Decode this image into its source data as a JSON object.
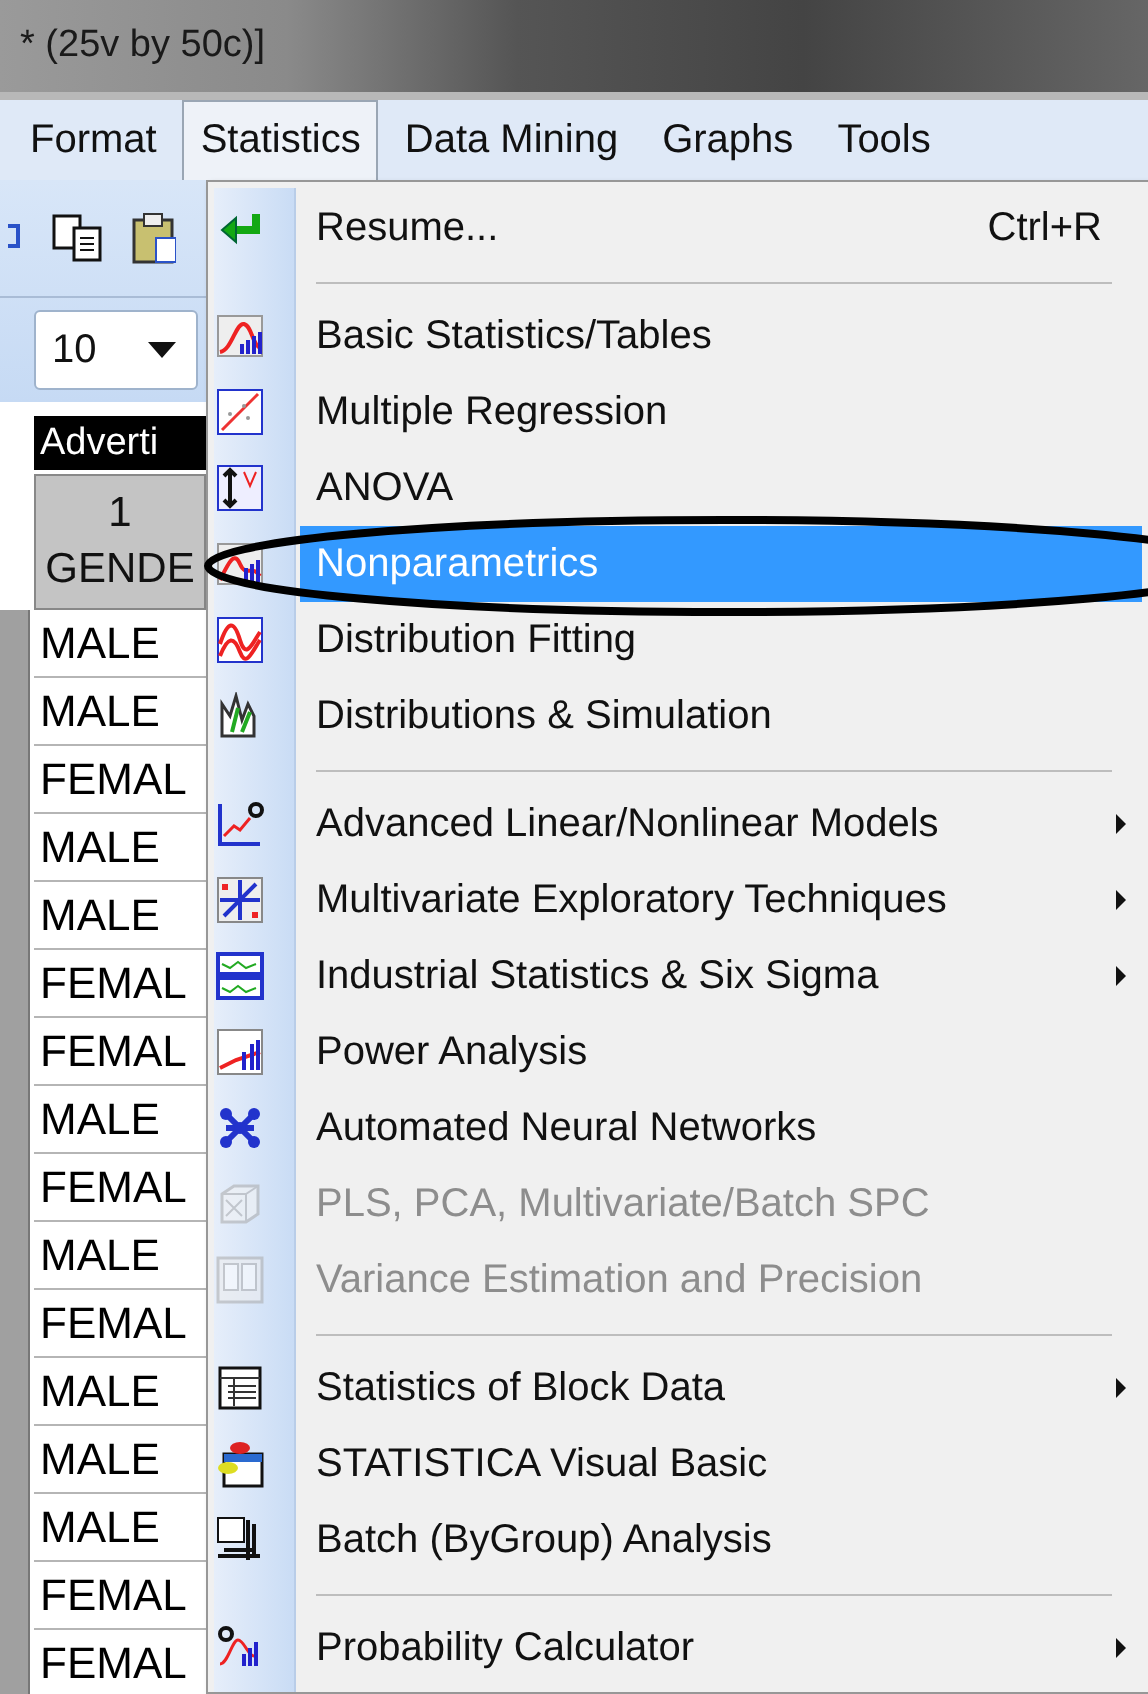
{
  "window": {
    "title": "* (25v by 50c)]"
  },
  "menubar": [
    {
      "label": "Format",
      "selected": false
    },
    {
      "label": "Statistics",
      "selected": true
    },
    {
      "label": "Data Mining",
      "selected": false
    },
    {
      "label": "Graphs",
      "selected": false
    },
    {
      "label": "Tools",
      "selected": false
    }
  ],
  "toolbar": {
    "zoom_value": "10"
  },
  "sheet": {
    "header": "Adverti",
    "column": {
      "number": "1",
      "name": "GENDE"
    },
    "rows": [
      "MALE",
      "MALE",
      "FEMAL",
      "MALE",
      "MALE",
      "FEMAL",
      "FEMAL",
      "MALE",
      "FEMAL",
      "MALE",
      "FEMAL",
      "MALE",
      "MALE",
      "MALE",
      "FEMAL",
      "FEMAL"
    ]
  },
  "menu": {
    "items": [
      {
        "kind": "item",
        "label": "Resume...",
        "shortcut": "Ctrl+R",
        "selected": false,
        "disabled": false,
        "submenu": false
      },
      {
        "kind": "separator"
      },
      {
        "kind": "item",
        "label": "Basic Statistics/Tables",
        "selected": false,
        "disabled": false,
        "submenu": false
      },
      {
        "kind": "item",
        "label": "Multiple Regression",
        "selected": false,
        "disabled": false,
        "submenu": false
      },
      {
        "kind": "item",
        "label": "ANOVA",
        "selected": false,
        "disabled": false,
        "submenu": false
      },
      {
        "kind": "item",
        "label": "Nonparametrics",
        "selected": true,
        "disabled": false,
        "submenu": false
      },
      {
        "kind": "item",
        "label": "Distribution Fitting",
        "selected": false,
        "disabled": false,
        "submenu": false
      },
      {
        "kind": "item",
        "label": "Distributions & Simulation",
        "selected": false,
        "disabled": false,
        "submenu": false
      },
      {
        "kind": "separator"
      },
      {
        "kind": "item",
        "label": "Advanced Linear/Nonlinear Models",
        "selected": false,
        "disabled": false,
        "submenu": true
      },
      {
        "kind": "item",
        "label": "Multivariate Exploratory Techniques",
        "selected": false,
        "disabled": false,
        "submenu": true
      },
      {
        "kind": "item",
        "label": "Industrial Statistics & Six Sigma",
        "selected": false,
        "disabled": false,
        "submenu": true
      },
      {
        "kind": "item",
        "label": "Power Analysis",
        "selected": false,
        "disabled": false,
        "submenu": false
      },
      {
        "kind": "item",
        "label": "Automated Neural Networks",
        "selected": false,
        "disabled": false,
        "submenu": false
      },
      {
        "kind": "item",
        "label": "PLS, PCA, Multivariate/Batch SPC",
        "selected": false,
        "disabled": true,
        "submenu": false
      },
      {
        "kind": "item",
        "label": "Variance Estimation and Precision",
        "selected": false,
        "disabled": true,
        "submenu": false
      },
      {
        "kind": "separator"
      },
      {
        "kind": "item",
        "label": "Statistics of Block Data",
        "selected": false,
        "disabled": false,
        "submenu": true
      },
      {
        "kind": "item",
        "label": "STATISTICA Visual Basic",
        "selected": false,
        "disabled": false,
        "submenu": false
      },
      {
        "kind": "item",
        "label": "Batch (ByGroup) Analysis",
        "selected": false,
        "disabled": false,
        "submenu": false
      },
      {
        "kind": "separator"
      },
      {
        "kind": "item",
        "label": "Probability Calculator",
        "selected": false,
        "disabled": false,
        "submenu": true
      }
    ]
  }
}
